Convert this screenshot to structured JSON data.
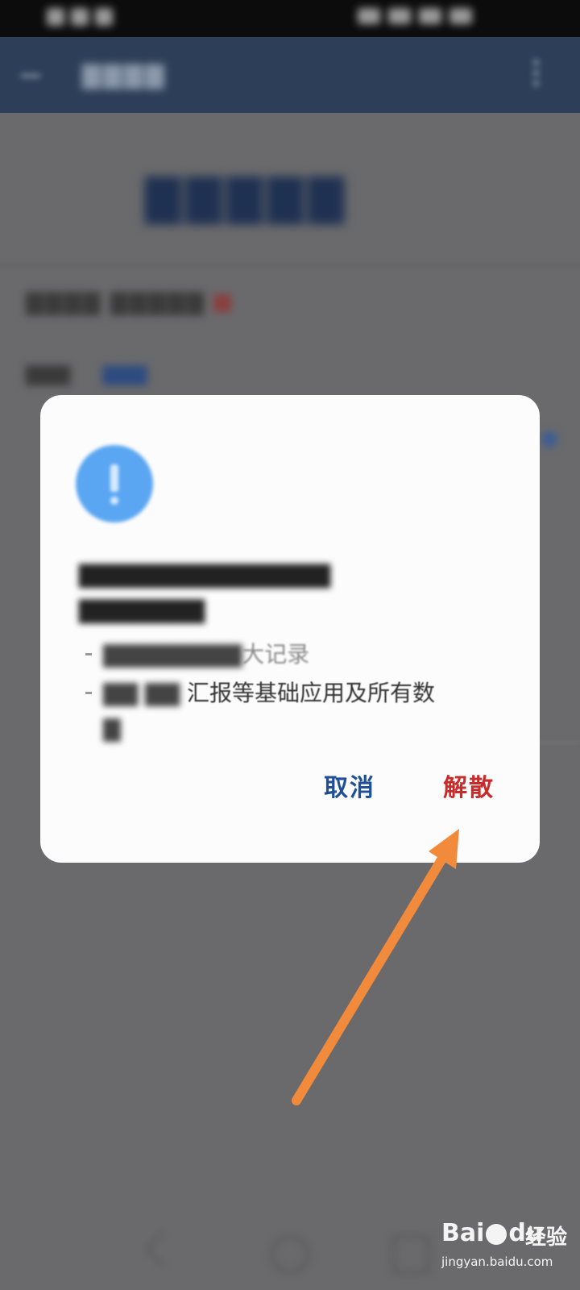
{
  "dialog": {
    "bullet_visible_tail": "汇报等基础应用及所有数",
    "bullet_visible_tail_2": "大记录",
    "cancel_label": "取消",
    "dissolve_label": "解散",
    "info_icon": "info-icon"
  },
  "watermark": {
    "logo": "Baidu",
    "text": "经验",
    "url": "jingyan.baidu.com"
  },
  "colors": {
    "cancel": "#1f4f94",
    "dissolve": "#c92b2b",
    "arrow": "#f28a3c"
  }
}
